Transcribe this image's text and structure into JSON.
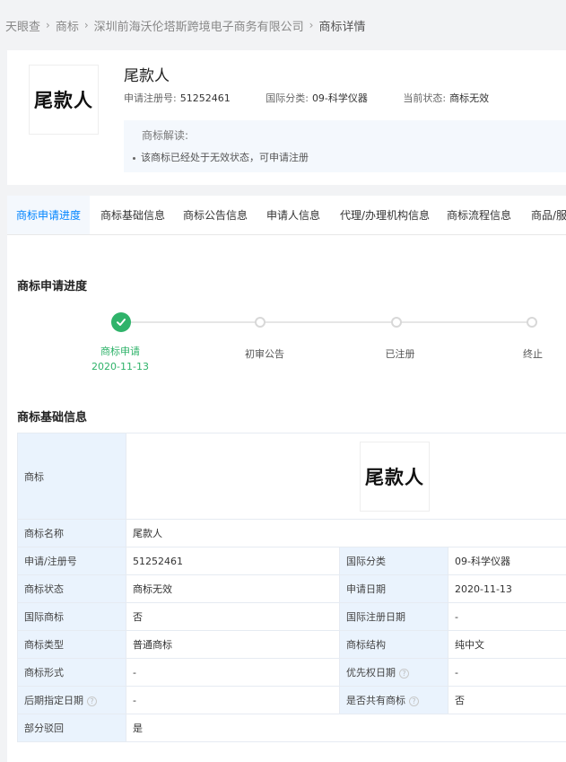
{
  "breadcrumb": {
    "items": [
      "天眼查",
      "商标",
      "深圳前海沃伦塔斯跨境电子商务有限公司",
      "商标详情"
    ],
    "separator": "›"
  },
  "trademark": {
    "logo_text": "尾款人",
    "name": "尾款人",
    "reg_no_label": "申请注册号:",
    "reg_no": "51252461",
    "class_label": "国际分类:",
    "class_value": "09-科学仪器",
    "status_label": "当前状态:",
    "status_value": "商标无效"
  },
  "interpret": {
    "heading": "商标解读:",
    "line": "该商标已经处于无效状态，可申请注册"
  },
  "tabs": [
    "商标申请进度",
    "商标基础信息",
    "商标公告信息",
    "申请人信息",
    "代理/办理机构信息",
    "商标流程信息",
    "商品/服务"
  ],
  "progress": {
    "title": "商标申请进度",
    "steps": [
      {
        "label": "商标申请",
        "date": "2020-11-13",
        "done": true
      },
      {
        "label": "初审公告",
        "date": "",
        "done": false
      },
      {
        "label": "已注册",
        "date": "",
        "done": false
      },
      {
        "label": "终止",
        "date": "",
        "done": false
      }
    ]
  },
  "basic": {
    "title": "商标基础信息",
    "mark_label": "商标",
    "mark_text": "尾款人",
    "rows": [
      {
        "k1": "商标名称",
        "v1": "尾款人"
      },
      {
        "k1": "申请/注册号",
        "v1": "51252461",
        "k2": "国际分类",
        "v2": "09-科学仪器"
      },
      {
        "k1": "商标状态",
        "v1": "商标无效",
        "k2": "申请日期",
        "v2": "2020-11-13"
      },
      {
        "k1": "国际商标",
        "v1": "否",
        "k2": "国际注册日期",
        "v2": "-"
      },
      {
        "k1": "商标类型",
        "v1": "普通商标",
        "k2": "商标结构",
        "v2": "纯中文"
      },
      {
        "k1": "商标形式",
        "v1": "-",
        "k2": "优先权日期",
        "v2": "-"
      },
      {
        "k1": "后期指定日期",
        "v1": "-",
        "k2": "是否共有商标",
        "v2": "否"
      },
      {
        "k1": "部分驳回",
        "v1": "是"
      }
    ],
    "help_glyph": "?"
  },
  "colors": {
    "accent": "#0084ff",
    "done": "#2fb36a",
    "key_bg": "#eaf3fd"
  }
}
